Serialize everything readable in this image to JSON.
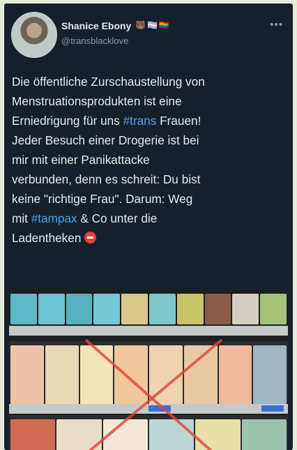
{
  "tweet": {
    "display_name": "Shanice Ebony",
    "badges": "🐻🏳️‍⚧️🏳️‍🌈",
    "handle": "@transblacklove",
    "more_icon": "more-dots-icon",
    "text": {
      "part1": "Die öffentliche Zurschaustellung von\nMenstruationsprodukten ist eine\nErniedrigung für uns ",
      "hashtag1": "#trans",
      "part2": " Frauen!\nJeder Besuch einer Drogerie ist bei\nmir mit einer Panikattacke\nverbunden, denn es schreit: Du bist\nkeine \"richtige Frau\". Darum: Weg\nmit ",
      "hashtag2": "#tampax",
      "part3": " & Co unter die\nLadentheken ",
      "emoji": "no-entry-emoji"
    },
    "photo": {
      "description_icon": "store-shelf-photo",
      "cross_color": "#e0463a",
      "shelf_colors": [
        "#5fb8c9",
        "#e8d9b4",
        "#efc2a8",
        "#f4e3b7"
      ]
    }
  }
}
